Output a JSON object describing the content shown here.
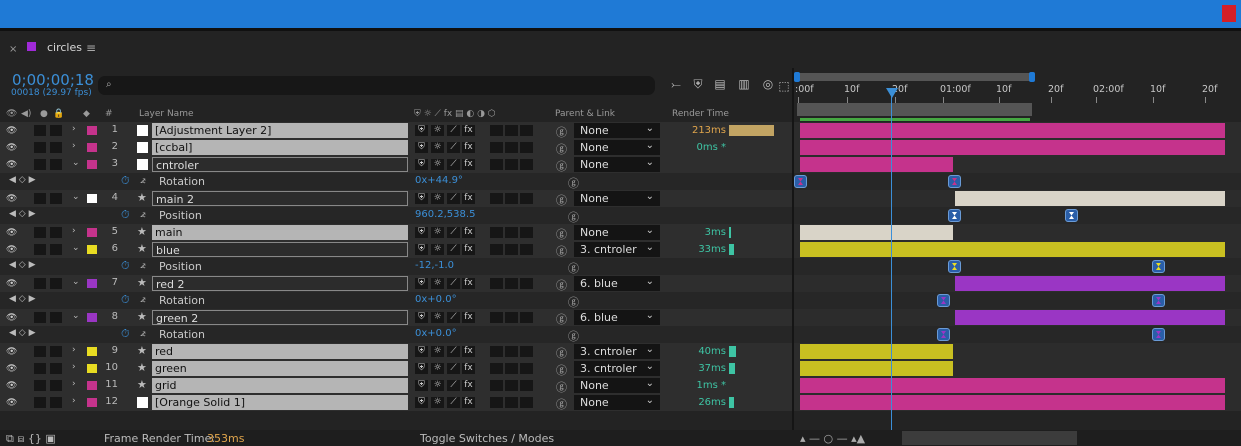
{
  "colors": {
    "accent": "#1f7ad6",
    "timecode": "#3b8fd7",
    "magenta": "#c5338c",
    "yellow": "#c9c021",
    "purple": "#9a36c4",
    "white": "#d9d4c8",
    "green_render": "#3ec4a4",
    "orange": "#f07f1e"
  },
  "tab": {
    "close_glyph": "×",
    "name": "circles",
    "menu_glyph": "≡"
  },
  "timecode": "0;00;00;18",
  "frame_info": "00018 (29.97 fps)",
  "search": {
    "icon": "search-icon",
    "placeholder": ""
  },
  "headers": {
    "layer_name": "Layer Name",
    "parent_link": "Parent & Link",
    "render_time": "Render Time",
    "num": "#"
  },
  "ruler": {
    "labels": [
      ":00f",
      "10f",
      "20f",
      "01:00f",
      "10f",
      "20f",
      "02:00f",
      "10f",
      "20f"
    ]
  },
  "rows": [
    {
      "type": "layer",
      "num": "1",
      "name": "[Adjustment Layer 2]",
      "label": "#c5338c",
      "star": false,
      "parent": "None",
      "render": "213ms",
      "render_frac": 1.0,
      "hi": true,
      "twirl": false
    },
    {
      "type": "layer",
      "num": "2",
      "name": "[ccbal]",
      "label": "#c5338c",
      "star": false,
      "parent": "None",
      "render": "0ms *",
      "render_frac": 0,
      "hi": false,
      "twirl": false
    },
    {
      "type": "layer",
      "num": "3",
      "name": "cntroler",
      "label": "#c5338c",
      "star": false,
      "parent": "None",
      "render": "",
      "render_frac": 0,
      "hi": false,
      "twirl": true
    },
    {
      "type": "prop",
      "prop": "Rotation",
      "value": "0x+44.9°"
    },
    {
      "type": "layer",
      "num": "4",
      "name": "main 2",
      "label": "#ffffff",
      "star": true,
      "parent": "None",
      "render": "",
      "render_frac": 0,
      "hi": false,
      "twirl": true
    },
    {
      "type": "prop",
      "prop": "Position",
      "value": "960.2,538.5"
    },
    {
      "type": "layer",
      "num": "5",
      "name": "main",
      "label": "#c5338c",
      "star": true,
      "parent": "None",
      "render": "3ms",
      "render_frac": 0.01,
      "hi": false,
      "twirl": false
    },
    {
      "type": "layer",
      "num": "6",
      "name": "blue",
      "label": "#e8dc22",
      "star": true,
      "parent": "3. cntroler",
      "render": "33ms",
      "render_frac": 0.1,
      "hi": false,
      "twirl": true
    },
    {
      "type": "prop",
      "prop": "Position",
      "value": "-12,-1.0"
    },
    {
      "type": "layer",
      "num": "7",
      "name": "red 2",
      "label": "#9a36c4",
      "star": true,
      "parent": "6. blue",
      "render": "",
      "render_frac": 0,
      "hi": false,
      "twirl": true
    },
    {
      "type": "prop",
      "prop": "Rotation",
      "value": "0x+0.0°"
    },
    {
      "type": "layer",
      "num": "8",
      "name": "green 2",
      "label": "#9a36c4",
      "star": true,
      "parent": "6. blue",
      "render": "",
      "render_frac": 0,
      "hi": false,
      "twirl": true
    },
    {
      "type": "prop",
      "prop": "Rotation",
      "value": "0x+0.0°"
    },
    {
      "type": "layer",
      "num": "9",
      "name": "red",
      "label": "#e8dc22",
      "star": true,
      "parent": "3. cntroler",
      "render": "40ms",
      "render_frac": 0.15,
      "hi": false,
      "twirl": false
    },
    {
      "type": "layer",
      "num": "10",
      "name": "green",
      "label": "#e8dc22",
      "star": true,
      "parent": "3. cntroler",
      "render": "37ms",
      "render_frac": 0.13,
      "hi": false,
      "twirl": false
    },
    {
      "type": "layer",
      "num": "11",
      "name": "grid",
      "label": "#c5338c",
      "star": true,
      "parent": "None",
      "render": "1ms *",
      "render_frac": 0,
      "hi": false,
      "twirl": false
    },
    {
      "type": "layer",
      "num": "12",
      "name": "[Orange Solid 1]",
      "label": "#c5338c",
      "star": false,
      "parent": "None",
      "render": "26ms",
      "render_frac": 0.1,
      "hi": false,
      "twirl": false
    }
  ],
  "bottom": {
    "frame_render_label": "Frame Render Time:",
    "frame_render_value": "353ms",
    "toggle": "Toggle Switches / Modes"
  }
}
